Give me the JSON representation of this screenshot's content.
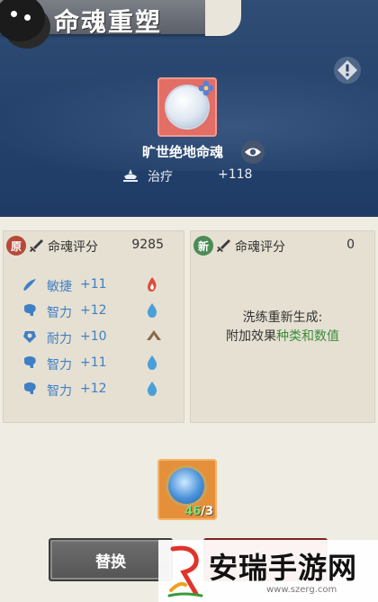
{
  "header": {
    "title": "命魂重塑"
  },
  "item": {
    "name": "旷世绝地命魂",
    "main_stat": {
      "label": "治疗",
      "value": "+118"
    }
  },
  "original_panel": {
    "seal": "原",
    "score_label": "命魂评分",
    "score": "9285",
    "stats": [
      {
        "name": "敏捷",
        "value": "+11",
        "icon": "agility-icon",
        "element": "fire"
      },
      {
        "name": "智力",
        "value": "+12",
        "icon": "intellect-icon",
        "element": "water"
      },
      {
        "name": "耐力",
        "value": "+10",
        "icon": "stamina-icon",
        "element": "earth"
      },
      {
        "name": "智力",
        "value": "+11",
        "icon": "intellect-icon",
        "element": "water"
      },
      {
        "name": "智力",
        "value": "+12",
        "icon": "intellect-icon",
        "element": "water"
      }
    ]
  },
  "new_panel": {
    "seal": "新",
    "score_label": "命魂评分",
    "score": "0",
    "note_line1": "洗练重新生成:",
    "note_line2_prefix": "附加效果",
    "note_line2_highlight": "种类和数值"
  },
  "material": {
    "have": "46",
    "need": "/3"
  },
  "buttons": {
    "replace": "替换"
  },
  "watermark": {
    "text": "安瑞手游网",
    "url": "www.szerg.com"
  },
  "colors": {
    "stat_blue": "#3f7fc4",
    "highlight_green": "#3d8c3c",
    "card_red": "#e26e66",
    "card_orange": "#e58f3a"
  }
}
